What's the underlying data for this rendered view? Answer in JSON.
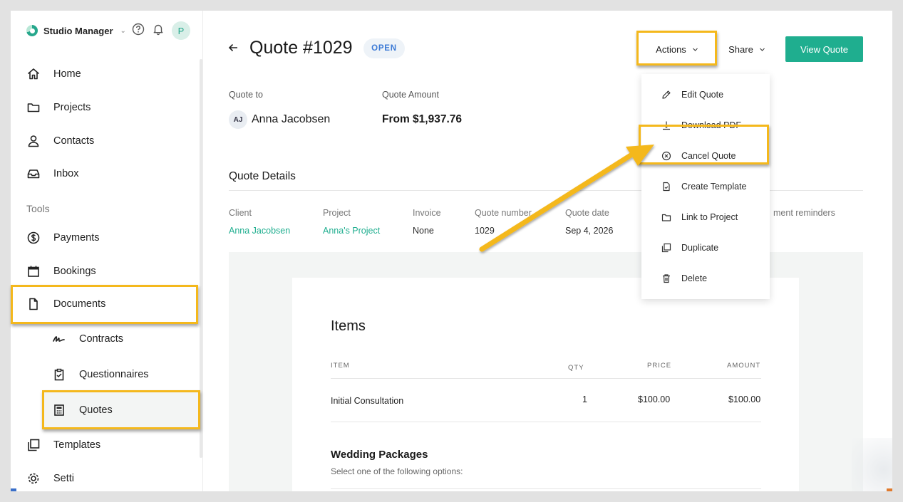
{
  "sidebar": {
    "brand": "Studio Manager",
    "avatar_initial": "P",
    "nav": [
      {
        "label": "Home",
        "icon": "home-icon"
      },
      {
        "label": "Projects",
        "icon": "folder-icon"
      },
      {
        "label": "Contacts",
        "icon": "person-icon"
      },
      {
        "label": "Inbox",
        "icon": "inbox-icon"
      }
    ],
    "tools_label": "Tools",
    "tools": [
      {
        "label": "Payments",
        "icon": "dollar-icon"
      },
      {
        "label": "Bookings",
        "icon": "calendar-icon"
      },
      {
        "label": "Documents",
        "icon": "document-icon"
      }
    ],
    "documents_sub": [
      {
        "label": "Contracts",
        "icon": "signature-icon"
      },
      {
        "label": "Questionnaires",
        "icon": "clipboard-icon"
      },
      {
        "label": "Quotes",
        "icon": "calculator-icon"
      }
    ],
    "templates_label": "Templates",
    "settings_partial": "Setti"
  },
  "header": {
    "title": "Quote #1029",
    "status": "OPEN",
    "actions_label": "Actions",
    "share_label": "Share",
    "view_label": "View Quote"
  },
  "summary": {
    "quote_to_label": "Quote to",
    "client_initials": "AJ",
    "client_name": "Anna Jacobsen",
    "amount_label": "Quote Amount",
    "amount_value": "From $1,937.76"
  },
  "details": {
    "title": "Quote Details",
    "fields": [
      {
        "label": "Client",
        "value": "Anna Jacobsen"
      },
      {
        "label": "Project",
        "value": "Anna's Project"
      },
      {
        "label": "Invoice",
        "value": "None"
      },
      {
        "label": "Quote number",
        "value": "1029"
      },
      {
        "label": "Quote date",
        "value": "Sep 4, 2026"
      }
    ],
    "reminders_partial": "ment reminders"
  },
  "document": {
    "items_title": "Items",
    "columns": [
      "ITEM",
      "QTY",
      "PRICE",
      "AMOUNT"
    ],
    "rows": [
      {
        "item": "Initial Consultation",
        "qty": "1",
        "price": "$100.00",
        "amount": "$100.00"
      }
    ],
    "packages_title": "Wedding Packages",
    "packages_sub": "Select one of the following options:"
  },
  "actions_menu": [
    {
      "label": "Edit Quote",
      "icon": "pencil-icon"
    },
    {
      "label": "Download PDF",
      "icon": "download-icon"
    },
    {
      "label": "Cancel Quote",
      "icon": "x-circle-icon"
    },
    {
      "label": "Create Template",
      "icon": "template-icon"
    },
    {
      "label": "Link to Project",
      "icon": "folder-link-icon"
    },
    {
      "label": "Duplicate",
      "icon": "duplicate-icon"
    },
    {
      "label": "Delete",
      "icon": "trash-icon"
    }
  ],
  "colors": {
    "accent": "#1fae8f",
    "highlight": "#f4b81c",
    "badge_text": "#3c7ad6"
  }
}
